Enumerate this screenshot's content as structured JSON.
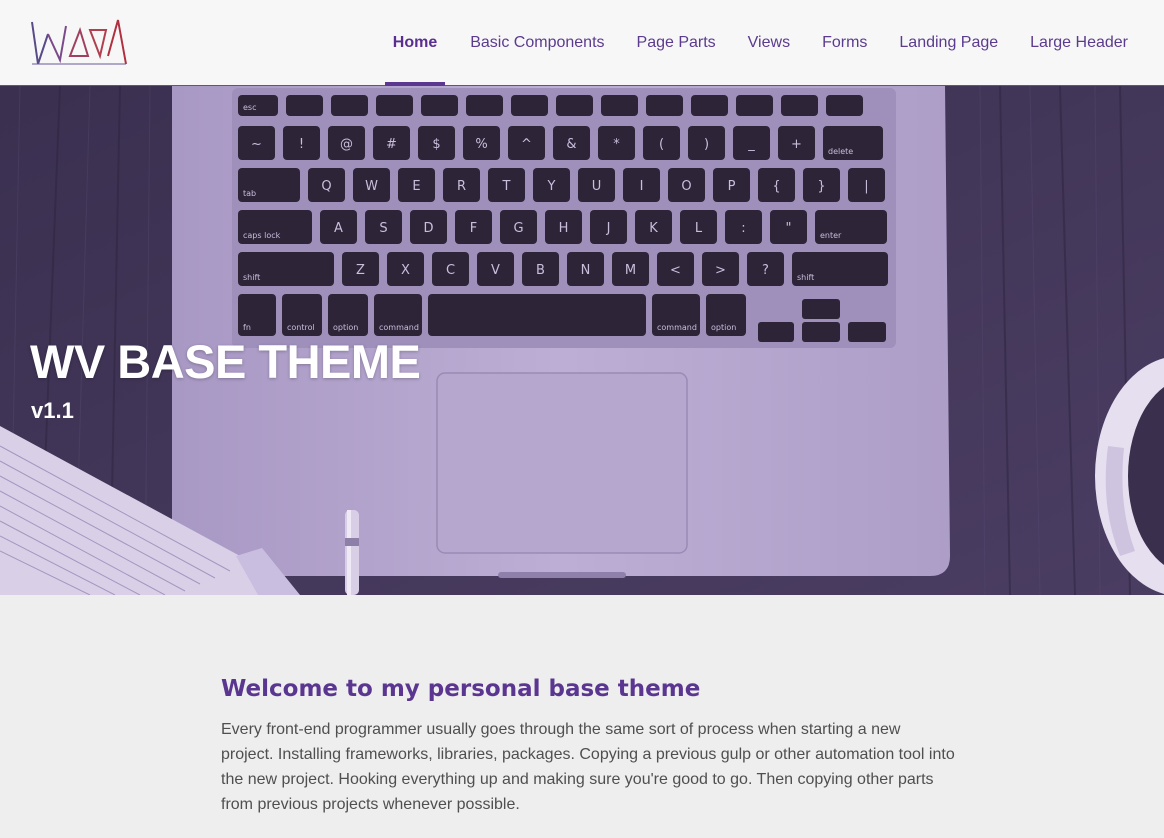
{
  "nav": {
    "items": [
      {
        "label": "Home",
        "active": true
      },
      {
        "label": "Basic Components"
      },
      {
        "label": "Page Parts"
      },
      {
        "label": "Views"
      },
      {
        "label": "Forms"
      },
      {
        "label": "Landing Page"
      },
      {
        "label": "Large Header"
      }
    ]
  },
  "hero": {
    "title": "WV BASE THEME",
    "version": "v1.1",
    "keyboard_rows": [
      [
        "esc",
        "",
        "",
        "",
        "",
        "",
        "",
        "",
        "",
        "",
        "",
        "",
        "",
        ""
      ],
      [
        "~",
        "!",
        "@",
        "#",
        "$",
        "%",
        "^",
        "&",
        "*",
        "(",
        ")",
        "_",
        "+",
        "delete"
      ],
      [
        "tab",
        "Q",
        "W",
        "E",
        "R",
        "T",
        "Y",
        "U",
        "I",
        "O",
        "P",
        "{",
        "}",
        "|"
      ],
      [
        "caps lock",
        "A",
        "S",
        "D",
        "F",
        "G",
        "H",
        "J",
        "K",
        "L",
        ":",
        "\"",
        "enter"
      ],
      [
        "shift",
        "Z",
        "X",
        "C",
        "V",
        "B",
        "N",
        "M",
        "<",
        ">",
        "?",
        "shift"
      ],
      [
        "fn",
        "control",
        "option",
        "command",
        "",
        "command",
        "option"
      ]
    ]
  },
  "content": {
    "heading": "Welcome to my personal base theme",
    "paragraph": "Every front-end programmer usually goes through the same sort of process when starting a new project. Installing frameworks, libraries, packages. Copying a previous gulp or other automation tool into the new project. Hooking everything up and making sure you're good to go. Then copying other parts from previous projects whenever possible."
  },
  "colors": {
    "accent": "#5c3790",
    "nav_text": "#5b3b8e",
    "hero_tint": "#4a3a66",
    "laptop": "#b7a8cf"
  }
}
